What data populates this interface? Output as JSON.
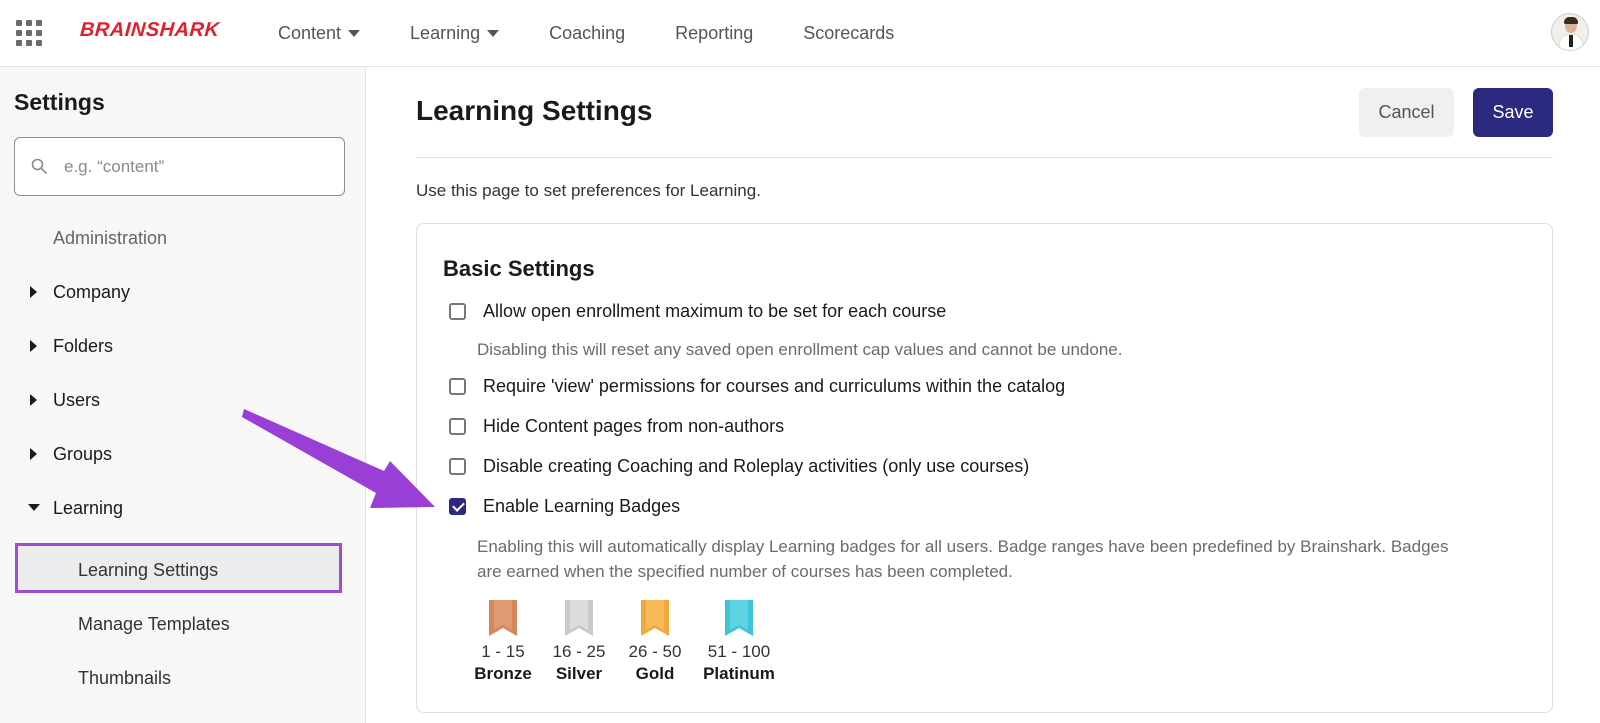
{
  "app": {
    "logo_text": "BRAINSHARK",
    "brand_color": "#e0202a",
    "accent_color": "#2b2a80",
    "highlight_color": "#9a4fd6"
  },
  "nav": {
    "items": [
      {
        "label": "Content",
        "has_dropdown": true
      },
      {
        "label": "Learning",
        "has_dropdown": true
      },
      {
        "label": "Coaching",
        "has_dropdown": false
      },
      {
        "label": "Reporting",
        "has_dropdown": false
      },
      {
        "label": "Scorecards",
        "has_dropdown": false
      }
    ]
  },
  "sidebar": {
    "title": "Settings",
    "search_placeholder": "e.g. “content”",
    "section_label": "Administration",
    "groups": [
      {
        "label": "Company",
        "expanded": false
      },
      {
        "label": "Folders",
        "expanded": false
      },
      {
        "label": "Users",
        "expanded": false
      },
      {
        "label": "Groups",
        "expanded": false
      },
      {
        "label": "Learning",
        "expanded": true
      }
    ],
    "learning_children": [
      {
        "label": "Learning Settings",
        "active": true
      },
      {
        "label": "Manage Templates",
        "active": false
      },
      {
        "label": "Thumbnails",
        "active": false
      }
    ]
  },
  "main": {
    "title": "Learning Settings",
    "cancel_label": "Cancel",
    "save_label": "Save",
    "intro": "Use this page to set preferences for Learning.",
    "card": {
      "title": "Basic Settings",
      "options": [
        {
          "label": "Allow open enrollment maximum to be set for each course",
          "checked": false
        },
        {
          "label": "Require 'view' permissions for courses and curriculums within the catalog",
          "checked": false
        },
        {
          "label": "Hide Content pages from non-authors",
          "checked": false
        },
        {
          "label": "Disable creating Coaching and Roleplay activities (only use courses)",
          "checked": false
        },
        {
          "label": "Enable Learning Badges",
          "checked": true
        }
      ],
      "helper_enrollment": "Disabling this will reset any saved open enrollment cap values and cannot be undone.",
      "helper_badges_line1": "Enabling this will automatically display Learning badges for all users. Badge ranges have been predefined by Brainshark. Badges",
      "helper_badges_line2": "are earned when the specified number of courses has been completed.",
      "badges": [
        {
          "range": "1 - 15",
          "name": "Bronze",
          "color": "#d4885e",
          "icon": "bronze-ribbon-icon"
        },
        {
          "range": "16 - 25",
          "name": "Silver",
          "color": "#cfcfcf",
          "icon": "silver-ribbon-icon"
        },
        {
          "range": "26 - 50",
          "name": "Gold",
          "color": "#f2a93b",
          "icon": "gold-ribbon-icon"
        },
        {
          "range": "51 - 100",
          "name": "Platinum",
          "color": "#3ec4d6",
          "icon": "platinum-ribbon-icon"
        }
      ]
    }
  }
}
